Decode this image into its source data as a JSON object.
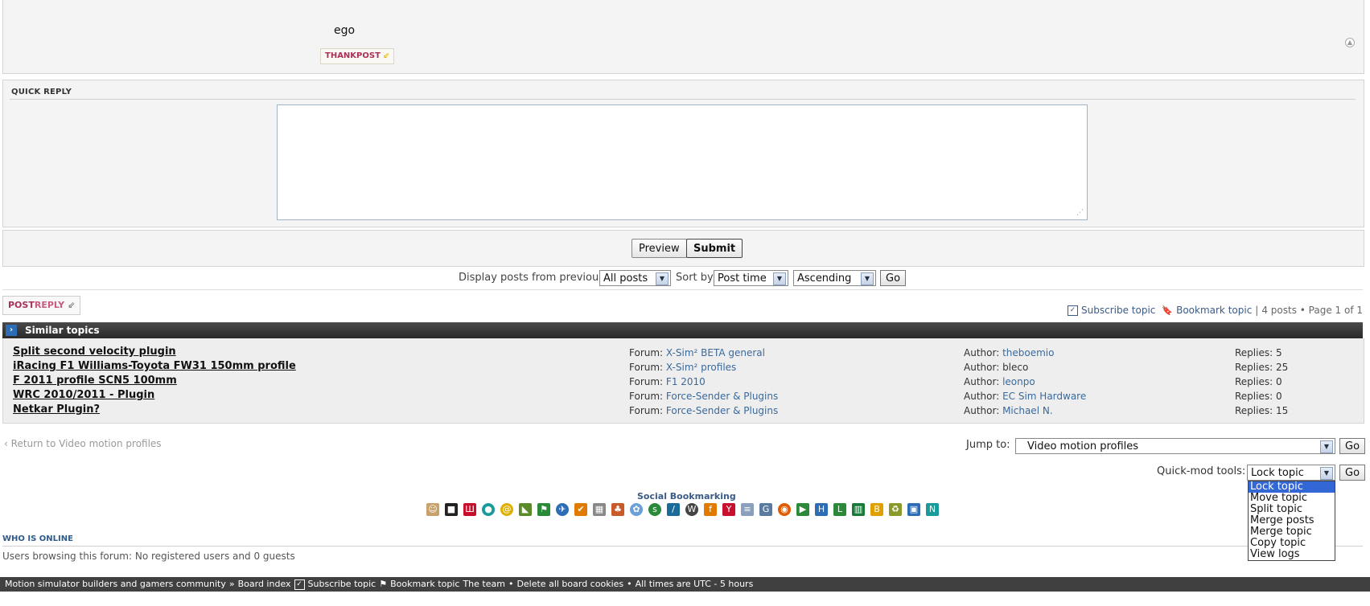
{
  "post": {
    "text": "ego",
    "thank_label": "THANKPOST"
  },
  "quick_reply": {
    "title": "QUICK REPLY",
    "message_value": "",
    "preview_label": "Preview",
    "submit_label": "Submit"
  },
  "sort_bar": {
    "display_label": "Display posts from previous:",
    "display_value": "All posts",
    "sort_label": "Sort by",
    "sort_value": "Post time",
    "order_value": "Ascending",
    "go_label": "Go"
  },
  "post_reply": {
    "label_pre": "POST",
    "label_post": "REPLY"
  },
  "topic_actions": {
    "subscribe": "Subscribe topic",
    "bookmark": "Bookmark topic",
    "separator": "|",
    "info": "4 posts • Page 1 of 1"
  },
  "similar_topics": {
    "header": "Similar topics",
    "forum_prefix": "Forum:",
    "author_prefix": "Author:",
    "replies_prefix": "Replies:",
    "rows": [
      {
        "title": "Split second velocity plugin",
        "forum": "X-Sim² BETA general",
        "author": "theboemio",
        "author_link": true,
        "replies": "5"
      },
      {
        "title": "iRacing F1 Williams-Toyota FW31 150mm profile",
        "forum": "X-Sim² profiles",
        "author": "bleco",
        "author_link": false,
        "replies": "25"
      },
      {
        "title": "F 2011 profile SCN5 100mm",
        "forum": "F1 2010",
        "author": "leonpo",
        "author_link": true,
        "replies": "0"
      },
      {
        "title": "WRC 2010/2011 - Plugin",
        "forum": "Force-Sender & Plugins",
        "author": "EC Sim Hardware",
        "author_link": true,
        "replies": "0"
      },
      {
        "title": "Netkar Plugin?",
        "forum": "Force-Sender & Plugins",
        "author": "Michael N.",
        "author_link": true,
        "replies": "15"
      }
    ]
  },
  "navigation": {
    "return_link": "Return to Video motion profiles",
    "jump_label": "Jump to:",
    "jump_value": "Video motion profiles",
    "go_label": "Go",
    "quickmod_label": "Quick-mod tools:",
    "quickmod_value": "Lock topic",
    "quickmod_options": [
      "Lock topic",
      "Move topic",
      "Split topic",
      "Merge posts",
      "Merge topic",
      "Copy topic",
      "View logs"
    ]
  },
  "social": {
    "title": "Social Bookmarking",
    "icons": [
      "digg-icon",
      "delicious-icon",
      "mixx-icon",
      "technorati-icon",
      "mister-wong-icon",
      "yigg-icon",
      "webnews-icon",
      "linkarena-icon",
      "oneview-icon",
      "folkd-icon",
      "icio-icon",
      "infopirat-icon",
      "myspace-icon",
      "stumbleupon-icon",
      "slashdot-icon",
      "wordpress-icon",
      "favoriten-icon",
      "yahoo-icon",
      "blinklist-icon",
      "google-icon",
      "reddit-icon",
      "seoigg-icon",
      "hatena-icon",
      "linkedin-icon",
      "netvibes-icon",
      "blogmarks-icon",
      "bonzobox-icon",
      "live-icon",
      "newsvine-icon"
    ],
    "colors": {
      "red": "#c8102e",
      "blue": "#2d6db5",
      "green": "#2a8a3a",
      "orange": "#e07b00",
      "teal": "#1a9a9a",
      "dark": "#222222"
    }
  },
  "who_is_online": {
    "title": "WHO IS ONLINE",
    "text": "Users browsing this forum: No registered users and 0 guests"
  },
  "footer": {
    "board": "Motion simulator builders and gamers community",
    "sep": "»",
    "index": "Board index",
    "subscribe": "Subscribe topic",
    "bookmark": "Bookmark topic",
    "team": "The team",
    "dot": "•",
    "cookies": "Delete all board cookies",
    "times": "All times are UTC - 5 hours"
  },
  "colors": {
    "accent_link": "#3a6a9c",
    "header_dark": "#3a3a3a",
    "button_brand": "#a8315a",
    "dropdown_highlight": "#3367d6"
  }
}
